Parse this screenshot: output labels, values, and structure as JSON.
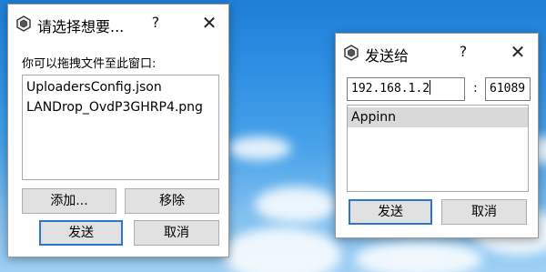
{
  "desktop": {
    "background_top": "#1f7fd8",
    "background_bottom": "#9fd0f4"
  },
  "dialog_select": {
    "title": "请选择想要...",
    "help_label": "?",
    "close_label": "✕",
    "prompt": "你可以拖拽文件至此窗口:",
    "files": [
      "UploadersConfig.json",
      "LANDrop_OvdP3GHRP4.png"
    ],
    "add_label": "添加...",
    "remove_label": "移除",
    "send_label": "发送",
    "cancel_label": "取消"
  },
  "dialog_send": {
    "title": "发送给",
    "help_label": "?",
    "close_label": "✕",
    "ip_value": "192.168.1.2",
    "port_separator": ":",
    "port_value": "61089",
    "devices": [
      "Appinn"
    ],
    "send_label": "发送",
    "cancel_label": "取消"
  },
  "colors": {
    "default_button_border": "#2f74cf",
    "selected_item": "#d9d9d9"
  },
  "icons": {
    "app": "landrop-app-icon",
    "help": "help-icon",
    "close": "close-icon"
  }
}
